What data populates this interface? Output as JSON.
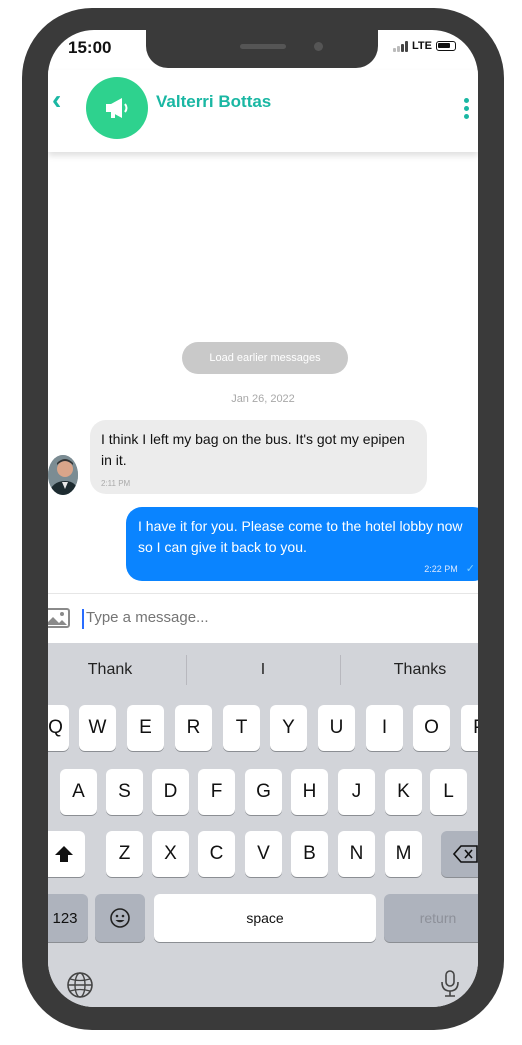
{
  "status": {
    "time": "15:00",
    "network": "LTE"
  },
  "header": {
    "contact_name": "Valterri Bottas"
  },
  "chat": {
    "load_earlier": "Load earlier messages",
    "date": "Jan 26, 2022",
    "messages": [
      {
        "direction": "in",
        "text": "I think I left my bag on the bus. It's got my epipen in it.",
        "time": "2:11 PM"
      },
      {
        "direction": "out",
        "text": "I have it for you. Please come to the hotel lobby now so I can give it back to you.",
        "time": "2:22 PM"
      }
    ]
  },
  "composer": {
    "placeholder": "Type a message..."
  },
  "keyboard": {
    "suggestions": [
      "Thank",
      "I",
      "Thanks"
    ],
    "row1": [
      "Q",
      "W",
      "E",
      "R",
      "T",
      "Y",
      "U",
      "I",
      "O",
      "P"
    ],
    "row2": [
      "A",
      "S",
      "D",
      "F",
      "G",
      "H",
      "J",
      "K",
      "L"
    ],
    "row3": [
      "Z",
      "X",
      "C",
      "V",
      "B",
      "N",
      "M"
    ],
    "numbers_label": "123",
    "space_label": "space",
    "return_label": "return"
  },
  "colors": {
    "accent": "#1ab7a3",
    "outgoing_bubble": "#0a84ff",
    "channel_avatar": "#2ed28e"
  }
}
